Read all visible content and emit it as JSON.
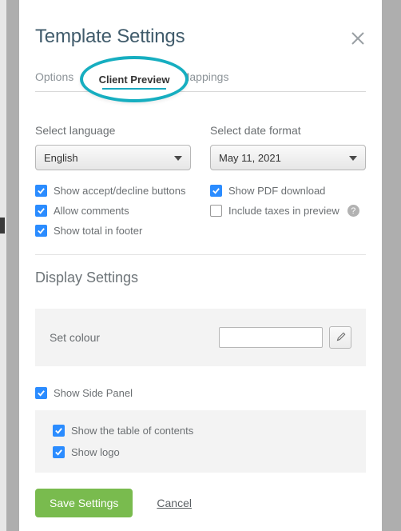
{
  "modal": {
    "title": "Template Settings"
  },
  "tabs": {
    "options": "Options",
    "client_preview": "Client Preview",
    "mappings": "Mappings"
  },
  "language": {
    "label": "Select language",
    "value": "English"
  },
  "date_format": {
    "label": "Select date format",
    "value": "May 11, 2021"
  },
  "checks": {
    "show_accept_decline": {
      "label": "Show accept/decline buttons",
      "checked": true
    },
    "allow_comments": {
      "label": "Allow comments",
      "checked": true
    },
    "show_total_footer": {
      "label": "Show total in footer",
      "checked": true
    },
    "show_pdf_download": {
      "label": "Show PDF download",
      "checked": true
    },
    "include_taxes": {
      "label": "Include taxes in preview",
      "checked": false
    }
  },
  "display": {
    "title": "Display Settings",
    "set_colour_label": "Set colour"
  },
  "side_panel": {
    "show_side_panel": {
      "label": "Show Side Panel",
      "checked": true
    },
    "show_toc": {
      "label": "Show the table of contents",
      "checked": true
    },
    "show_logo": {
      "label": "Show logo",
      "checked": true
    }
  },
  "buttons": {
    "save": "Save Settings",
    "cancel": "Cancel"
  }
}
